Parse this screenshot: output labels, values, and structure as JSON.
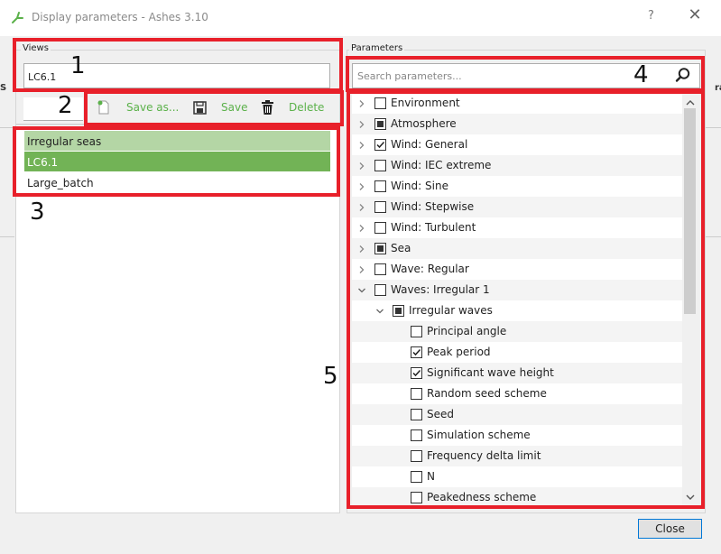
{
  "window": {
    "title": "Display parameters - Ashes 3.10",
    "help_label": "?",
    "close_glyph": "✕"
  },
  "background_peek": {
    "left_text": "S",
    "right_text": "ra"
  },
  "views": {
    "group_title": "Views",
    "current_value": "LC6.1",
    "toolbar": {
      "save_as_label": "Save as...",
      "save_label": "Save",
      "delete_label": "Delete"
    },
    "items": [
      {
        "label": "Irregular seas",
        "state": "highlighted"
      },
      {
        "label": "LC6.1",
        "state": "selected"
      },
      {
        "label": "Large_batch",
        "state": "normal"
      }
    ]
  },
  "parameters": {
    "group_title": "Parameters",
    "search_placeholder": "Search parameters...",
    "tree": [
      {
        "label": "Environment",
        "level": 0,
        "expander": "collapsed",
        "check": "unchecked"
      },
      {
        "label": "Atmosphere",
        "level": 0,
        "expander": "collapsed",
        "check": "partial"
      },
      {
        "label": "Wind: General",
        "level": 0,
        "expander": "collapsed",
        "check": "checked"
      },
      {
        "label": "Wind: IEC extreme",
        "level": 0,
        "expander": "collapsed",
        "check": "unchecked"
      },
      {
        "label": "Wind: Sine",
        "level": 0,
        "expander": "collapsed",
        "check": "unchecked"
      },
      {
        "label": "Wind: Stepwise",
        "level": 0,
        "expander": "collapsed",
        "check": "unchecked"
      },
      {
        "label": "Wind: Turbulent",
        "level": 0,
        "expander": "collapsed",
        "check": "unchecked"
      },
      {
        "label": "Sea",
        "level": 0,
        "expander": "collapsed",
        "check": "partial"
      },
      {
        "label": "Wave: Regular",
        "level": 0,
        "expander": "collapsed",
        "check": "unchecked"
      },
      {
        "label": "Waves: Irregular 1",
        "level": 0,
        "expander": "expanded",
        "check": "unchecked"
      },
      {
        "label": "Irregular waves",
        "level": 1,
        "expander": "expanded",
        "check": "partial"
      },
      {
        "label": "Principal angle",
        "level": 2,
        "expander": "none",
        "check": "unchecked"
      },
      {
        "label": "Peak period",
        "level": 2,
        "expander": "none",
        "check": "checked"
      },
      {
        "label": "Significant wave height",
        "level": 2,
        "expander": "none",
        "check": "checked"
      },
      {
        "label": "Random seed scheme",
        "level": 2,
        "expander": "none",
        "check": "unchecked"
      },
      {
        "label": "Seed",
        "level": 2,
        "expander": "none",
        "check": "unchecked"
      },
      {
        "label": "Simulation scheme",
        "level": 2,
        "expander": "none",
        "check": "unchecked"
      },
      {
        "label": "Frequency delta limit",
        "level": 2,
        "expander": "none",
        "check": "unchecked"
      },
      {
        "label": "N",
        "level": 2,
        "expander": "none",
        "check": "unchecked"
      },
      {
        "label": "Peakedness scheme",
        "level": 2,
        "expander": "none",
        "check": "unchecked"
      }
    ]
  },
  "annotations": [
    "1",
    "2",
    "3",
    "4",
    "5"
  ],
  "footer": {
    "close_label": "Close"
  },
  "colors": {
    "accent_green": "#5bb14a",
    "selected_green": "#72b356",
    "highlight_green": "#b4d6a5",
    "annotation_red": "#e8202a"
  }
}
